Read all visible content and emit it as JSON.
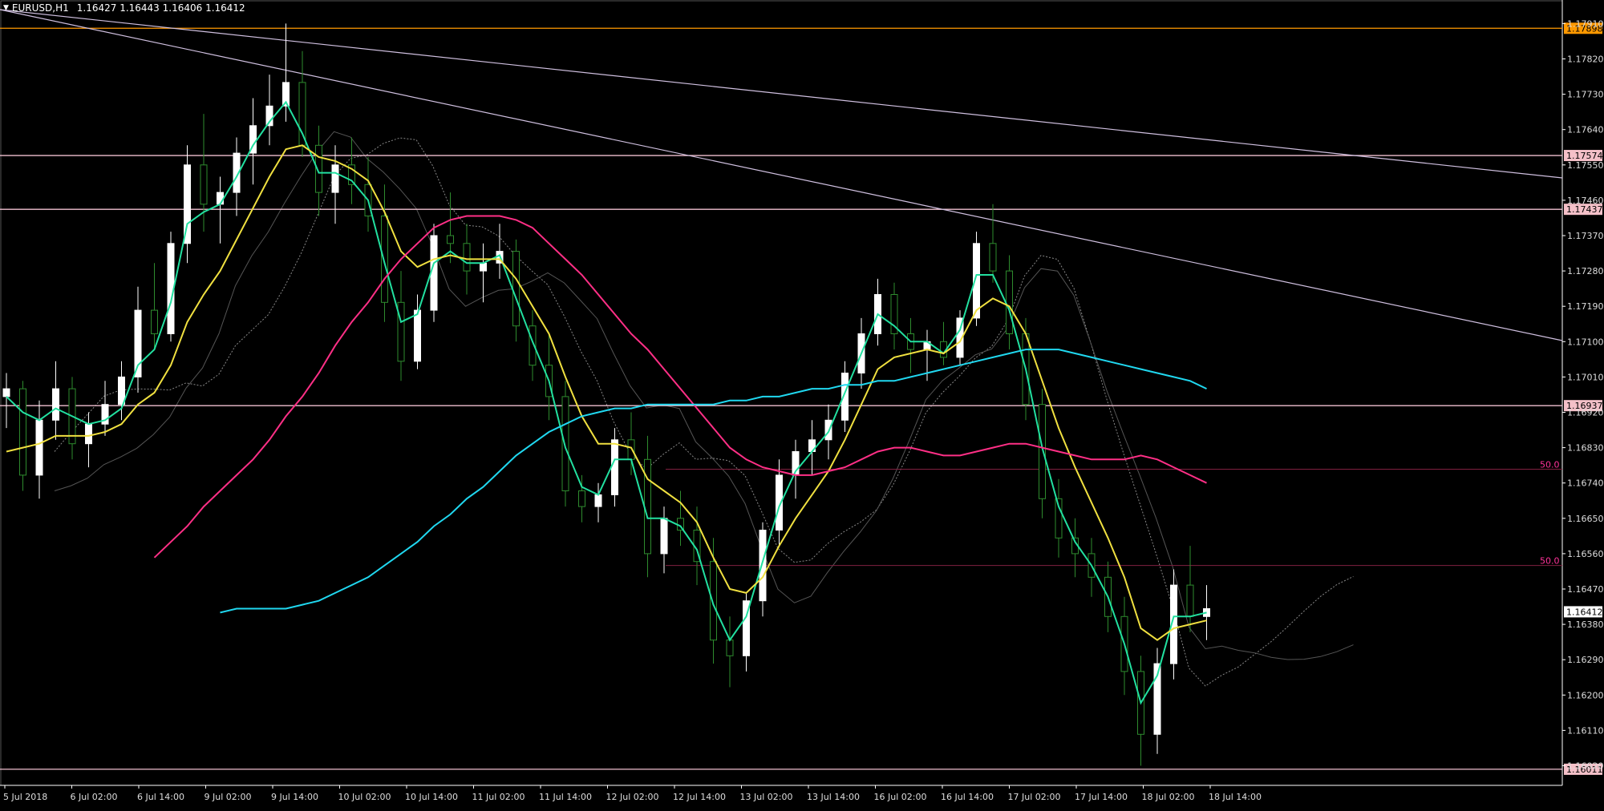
{
  "header": {
    "symbol": "EURUSD,H1",
    "ohlc": "1.16427 1.16443 1.16406 1.16412"
  },
  "colors": {
    "background": "#000000",
    "axis": "#ffffff",
    "bull": "#ffffff",
    "bear": "#2e8b2e",
    "ema_fast": "#22e0a0",
    "ema_slow": "#f0e040",
    "ema_mid": "#ff2f86",
    "ema_long": "#20d8f0",
    "hline": "#f0c0d0",
    "orange_line": "#ff9900",
    "trendline": "#d0c0e0",
    "fib_label": "#ff3399",
    "cloud": "#888888"
  },
  "chart_data": {
    "type": "candlestick",
    "symbol": "EURUSD",
    "timeframe": "H1",
    "ylim": [
      1.1597,
      1.1797
    ],
    "y_ticks": [
      "1.17910",
      "1.17820",
      "1.17730",
      "1.17640",
      "1.17550",
      "1.17460",
      "1.17370",
      "1.17280",
      "1.17190",
      "1.17100",
      "1.17010",
      "1.16920",
      "1.16830",
      "1.16740",
      "1.16650",
      "1.16560",
      "1.16470",
      "1.16380",
      "1.16290",
      "1.16200",
      "1.16110",
      "1.16020"
    ],
    "x_labels": [
      "5 Jul 2018",
      "6 Jul 02:00",
      "6 Jul 14:00",
      "9 Jul 02:00",
      "9 Jul 14:00",
      "10 Jul 02:00",
      "10 Jul 14:00",
      "11 Jul 02:00",
      "11 Jul 14:00",
      "12 Jul 02:00",
      "12 Jul 14:00",
      "13 Jul 02:00",
      "13 Jul 14:00",
      "16 Jul 02:00",
      "16 Jul 14:00",
      "17 Jul 02:00",
      "17 Jul 14:00",
      "18 Jul 02:00",
      "18 Jul 14:00"
    ],
    "horizontal_levels": [
      {
        "value": 1.17898,
        "label": "1.17898",
        "style": "orange"
      },
      {
        "value": 1.17574,
        "label": "1.17574",
        "style": "pink"
      },
      {
        "value": 1.17437,
        "label": "1.17437",
        "style": "pink"
      },
      {
        "value": 1.16937,
        "label": "1.16937",
        "style": "pink"
      },
      {
        "value": 1.16011,
        "label": "1.16011",
        "style": "pink"
      }
    ],
    "current_price": {
      "value": 1.16412,
      "label": "1.16412"
    },
    "fib_labels": [
      {
        "label": "50.0",
        "value": 1.16775
      },
      {
        "label": "50.0",
        "value": 1.1653
      }
    ],
    "candles": [
      [
        1.1696,
        1.1702,
        1.1688,
        1.1698
      ],
      [
        1.1698,
        1.17,
        1.1672,
        1.1676
      ],
      [
        1.1676,
        1.1695,
        1.167,
        1.169
      ],
      [
        1.169,
        1.1705,
        1.1685,
        1.1698
      ],
      [
        1.1698,
        1.1701,
        1.168,
        1.1684
      ],
      [
        1.1684,
        1.1692,
        1.1678,
        1.1689
      ],
      [
        1.1689,
        1.17,
        1.1686,
        1.1694
      ],
      [
        1.1694,
        1.1705,
        1.169,
        1.1701
      ],
      [
        1.1701,
        1.1724,
        1.1697,
        1.1718
      ],
      [
        1.1718,
        1.173,
        1.1708,
        1.1712
      ],
      [
        1.1712,
        1.1738,
        1.171,
        1.1735
      ],
      [
        1.1735,
        1.176,
        1.173,
        1.1755
      ],
      [
        1.1755,
        1.1768,
        1.1738,
        1.1745
      ],
      [
        1.1745,
        1.1752,
        1.1735,
        1.1748
      ],
      [
        1.1748,
        1.1762,
        1.1742,
        1.1758
      ],
      [
        1.1758,
        1.1772,
        1.175,
        1.1765
      ],
      [
        1.1765,
        1.1778,
        1.176,
        1.177
      ],
      [
        1.177,
        1.1791,
        1.1766,
        1.1776
      ],
      [
        1.1776,
        1.1784,
        1.1757,
        1.176
      ],
      [
        1.176,
        1.1765,
        1.1742,
        1.1748
      ],
      [
        1.1748,
        1.176,
        1.174,
        1.1755
      ],
      [
        1.1755,
        1.1762,
        1.1745,
        1.175
      ],
      [
        1.175,
        1.1757,
        1.1738,
        1.1742
      ],
      [
        1.1742,
        1.175,
        1.1715,
        1.172
      ],
      [
        1.172,
        1.1728,
        1.17,
        1.1705
      ],
      [
        1.1705,
        1.1722,
        1.1703,
        1.1718
      ],
      [
        1.1718,
        1.174,
        1.1715,
        1.1737
      ],
      [
        1.1737,
        1.1748,
        1.173,
        1.1735
      ],
      [
        1.1735,
        1.174,
        1.1722,
        1.1728
      ],
      [
        1.1728,
        1.1735,
        1.172,
        1.173
      ],
      [
        1.173,
        1.174,
        1.1726,
        1.1733
      ],
      [
        1.1733,
        1.1736,
        1.171,
        1.1714
      ],
      [
        1.1714,
        1.1718,
        1.17,
        1.1704
      ],
      [
        1.1704,
        1.1712,
        1.169,
        1.1696
      ],
      [
        1.1696,
        1.17,
        1.1668,
        1.1672
      ],
      [
        1.1672,
        1.1676,
        1.1664,
        1.1668
      ],
      [
        1.1668,
        1.1674,
        1.1664,
        1.1671
      ],
      [
        1.1671,
        1.1688,
        1.1668,
        1.1685
      ],
      [
        1.1685,
        1.1692,
        1.1676,
        1.168
      ],
      [
        1.168,
        1.1686,
        1.165,
        1.1656
      ],
      [
        1.1656,
        1.1668,
        1.1651,
        1.1665
      ],
      [
        1.1665,
        1.1672,
        1.1658,
        1.1662
      ],
      [
        1.1662,
        1.1668,
        1.1648,
        1.1654
      ],
      [
        1.1654,
        1.166,
        1.1628,
        1.1634
      ],
      [
        1.1634,
        1.164,
        1.1622,
        1.163
      ],
      [
        1.163,
        1.1646,
        1.1626,
        1.1644
      ],
      [
        1.1644,
        1.1664,
        1.164,
        1.1662
      ],
      [
        1.1662,
        1.168,
        1.1658,
        1.1676
      ],
      [
        1.1676,
        1.1685,
        1.167,
        1.1682
      ],
      [
        1.1682,
        1.169,
        1.1676,
        1.1685
      ],
      [
        1.1685,
        1.1694,
        1.168,
        1.169
      ],
      [
        1.169,
        1.1705,
        1.1687,
        1.1702
      ],
      [
        1.1702,
        1.1716,
        1.1698,
        1.1712
      ],
      [
        1.1712,
        1.1726,
        1.1709,
        1.1722
      ],
      [
        1.1722,
        1.1725,
        1.1708,
        1.1712
      ],
      [
        1.1712,
        1.1716,
        1.1702,
        1.1708
      ],
      [
        1.1708,
        1.1713,
        1.17,
        1.171
      ],
      [
        1.171,
        1.1715,
        1.1704,
        1.1706
      ],
      [
        1.1706,
        1.1718,
        1.1704,
        1.1716
      ],
      [
        1.1716,
        1.1738,
        1.1714,
        1.1735
      ],
      [
        1.1735,
        1.1745,
        1.1725,
        1.1728
      ],
      [
        1.1728,
        1.1732,
        1.1708,
        1.1712
      ],
      [
        1.1712,
        1.1716,
        1.169,
        1.1694
      ],
      [
        1.1694,
        1.1698,
        1.1665,
        1.167
      ],
      [
        1.167,
        1.1675,
        1.1655,
        1.166
      ],
      [
        1.166,
        1.1665,
        1.165,
        1.1656
      ],
      [
        1.1656,
        1.166,
        1.1645,
        1.165
      ],
      [
        1.165,
        1.1654,
        1.1636,
        1.164
      ],
      [
        1.164,
        1.1645,
        1.162,
        1.1626
      ],
      [
        1.1626,
        1.163,
        1.1602,
        1.161
      ],
      [
        1.161,
        1.1632,
        1.1605,
        1.1628
      ],
      [
        1.1628,
        1.1652,
        1.1624,
        1.1648
      ],
      [
        1.1648,
        1.1658,
        1.1636,
        1.164
      ],
      [
        1.164,
        1.1648,
        1.1634,
        1.1642
      ]
    ],
    "series": [
      {
        "name": "ema_fast",
        "color": "#22e0a0",
        "values": [
          1.1696,
          1.1692,
          1.169,
          1.1693,
          1.1691,
          1.1689,
          1.169,
          1.1693,
          1.1704,
          1.1708,
          1.172,
          1.174,
          1.1743,
          1.1745,
          1.1752,
          1.176,
          1.1766,
          1.1771,
          1.1763,
          1.1753,
          1.1753,
          1.1751,
          1.1746,
          1.173,
          1.1715,
          1.1717,
          1.173,
          1.1733,
          1.173,
          1.173,
          1.1732,
          1.1721,
          1.171,
          1.17,
          1.1683,
          1.1673,
          1.1671,
          1.168,
          1.168,
          1.1665,
          1.1665,
          1.1663,
          1.1657,
          1.1643,
          1.1634,
          1.164,
          1.1654,
          1.1668,
          1.1677,
          1.1682,
          1.1687,
          1.1697,
          1.1707,
          1.1717,
          1.1714,
          1.171,
          1.171,
          1.1707,
          1.1713,
          1.1727,
          1.1727,
          1.1718,
          1.1703,
          1.1683,
          1.1668,
          1.1659,
          1.1653,
          1.1645,
          1.1633,
          1.1618,
          1.1625,
          1.164,
          1.164,
          1.1641
        ]
      },
      {
        "name": "ema_slow",
        "color": "#f0e040",
        "values": [
          1.1682,
          1.1683,
          1.1684,
          1.1686,
          1.1686,
          1.1686,
          1.1687,
          1.1689,
          1.1694,
          1.1697,
          1.1704,
          1.1715,
          1.1722,
          1.1728,
          1.1736,
          1.1744,
          1.1752,
          1.1759,
          1.176,
          1.1757,
          1.1756,
          1.1754,
          1.1751,
          1.1743,
          1.1733,
          1.1729,
          1.1731,
          1.1732,
          1.1731,
          1.1731,
          1.1731,
          1.1726,
          1.1719,
          1.1712,
          1.1701,
          1.1691,
          1.1684,
          1.1684,
          1.1683,
          1.1675,
          1.1672,
          1.1669,
          1.1664,
          1.1655,
          1.1647,
          1.1646,
          1.165,
          1.1658,
          1.1665,
          1.1671,
          1.1677,
          1.1685,
          1.1694,
          1.1703,
          1.1706,
          1.1707,
          1.1708,
          1.1707,
          1.171,
          1.1718,
          1.1721,
          1.1719,
          1.1712,
          1.17,
          1.1688,
          1.1678,
          1.1669,
          1.166,
          1.165,
          1.1637,
          1.1634,
          1.1637,
          1.1638,
          1.1639
        ]
      },
      {
        "name": "ema_mid",
        "color": "#ff2f86",
        "values": [
          1.1655,
          1.1659,
          1.1663,
          1.1668,
          1.1672,
          1.1676,
          1.168,
          1.1685,
          1.1691,
          1.1696,
          1.1702,
          1.1709,
          1.1715,
          1.172,
          1.1726,
          1.1731,
          1.1735,
          1.1739,
          1.1741,
          1.1742,
          1.1742,
          1.1742,
          1.1741,
          1.1739,
          1.1735,
          1.1731,
          1.1727,
          1.1722,
          1.1717,
          1.1712,
          1.1708,
          1.1703,
          1.1698,
          1.1693,
          1.1688,
          1.1683,
          1.168,
          1.1678,
          1.1677,
          1.1676,
          1.1676,
          1.1677,
          1.1678,
          1.168,
          1.1682,
          1.1683,
          1.1683,
          1.1682,
          1.1681,
          1.1681,
          1.1682,
          1.1683,
          1.1684,
          1.1684,
          1.1683,
          1.1682,
          1.1681,
          1.168,
          1.168,
          1.168,
          1.1681,
          1.168,
          1.1678,
          1.1676,
          1.1674
        ]
      },
      {
        "name": "ema_long",
        "color": "#20d8f0",
        "values": [
          1.1641,
          1.1642,
          1.1642,
          1.1642,
          1.1642,
          1.1643,
          1.1644,
          1.1646,
          1.1648,
          1.165,
          1.1653,
          1.1656,
          1.1659,
          1.1663,
          1.1666,
          1.167,
          1.1673,
          1.1677,
          1.1681,
          1.1684,
          1.1687,
          1.1689,
          1.1691,
          1.1692,
          1.1693,
          1.1693,
          1.1694,
          1.1694,
          1.1694,
          1.1694,
          1.1694,
          1.1695,
          1.1695,
          1.1696,
          1.1696,
          1.1697,
          1.1698,
          1.1698,
          1.1699,
          1.1699,
          1.17,
          1.17,
          1.1701,
          1.1702,
          1.1703,
          1.1704,
          1.1705,
          1.1706,
          1.1707,
          1.1708,
          1.1708,
          1.1708,
          1.1707,
          1.1706,
          1.1705,
          1.1704,
          1.1703,
          1.1702,
          1.1701,
          1.17,
          1.1698
        ]
      }
    ]
  }
}
